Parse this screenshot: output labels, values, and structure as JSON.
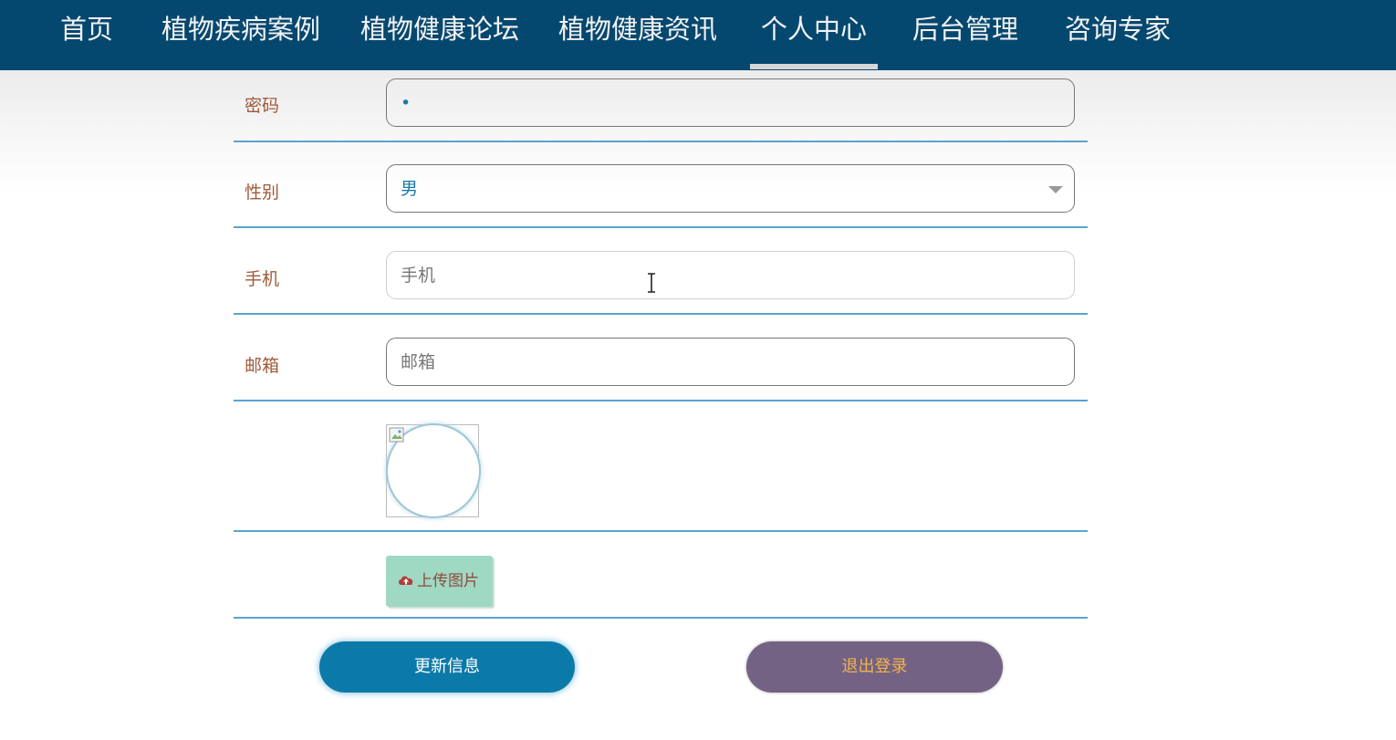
{
  "nav": {
    "items": [
      {
        "label": "首页"
      },
      {
        "label": "植物疾病案例"
      },
      {
        "label": "植物健康论坛"
      },
      {
        "label": "植物健康资讯"
      },
      {
        "label": "个人中心"
      },
      {
        "label": "后台管理"
      },
      {
        "label": "咨询专家"
      }
    ],
    "active": "个人中心"
  },
  "form": {
    "password": {
      "label": "密码",
      "value": "•"
    },
    "gender": {
      "label": "性别",
      "value": "男"
    },
    "phone": {
      "label": "手机",
      "placeholder": "手机"
    },
    "email": {
      "label": "邮箱",
      "placeholder": "邮箱"
    },
    "upload_label": "上传图片"
  },
  "actions": {
    "update": "更新信息",
    "logout": "退出登录"
  },
  "colors": {
    "nav_bg": "#05486f",
    "label": "#a05a3a",
    "divider": "#5aa3cf",
    "update_bg": "#0c7aa8",
    "logout_bg": "#736284",
    "logout_text": "#f2b34a",
    "upload_bg": "#9fd8c3"
  },
  "icons": [
    "cloud-upload-icon",
    "chevron-down-icon",
    "broken-image-icon",
    "text-cursor-icon"
  ]
}
